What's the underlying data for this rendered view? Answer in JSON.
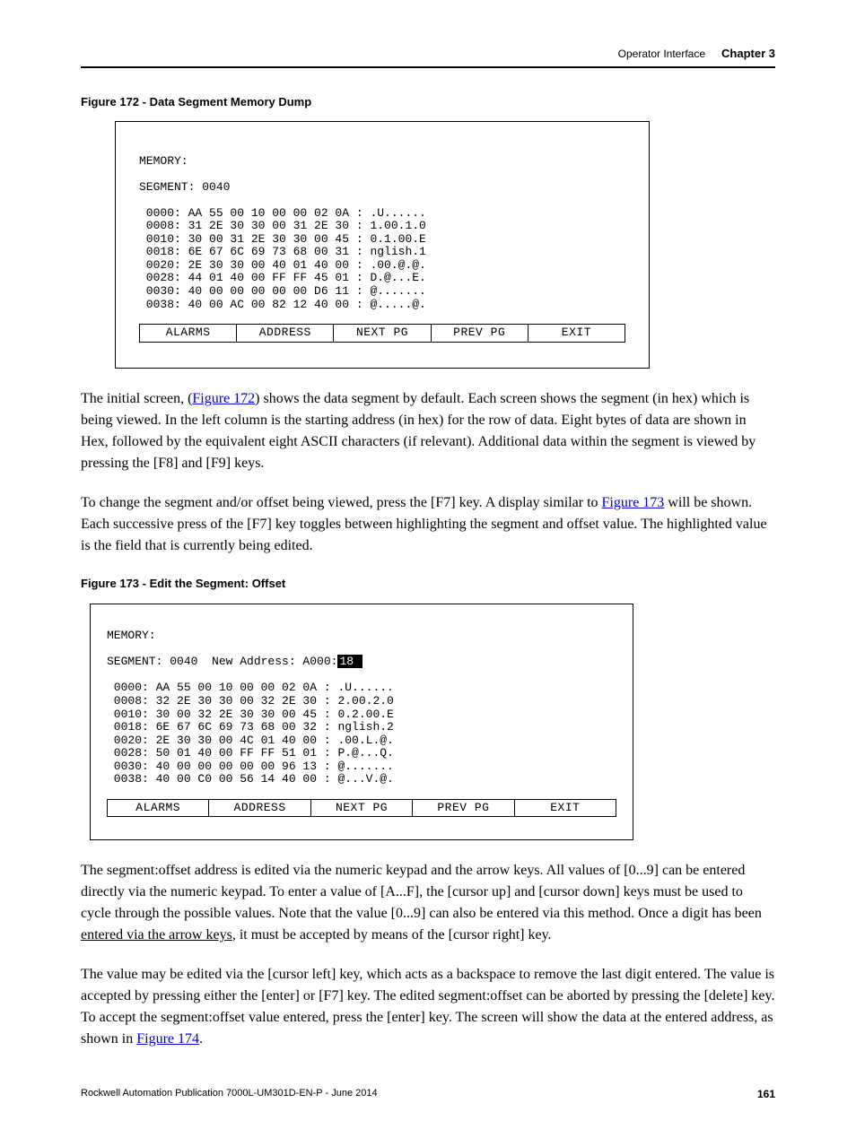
{
  "header": {
    "section": "Operator Interface",
    "chapter": "Chapter 3"
  },
  "figure172": {
    "caption": "Figure 172 - Data Segment Memory Dump",
    "title": "MEMORY:",
    "segment_line": "SEGMENT: 0040",
    "rows": [
      " 0000: AA 55 00 10 00 00 02 0A : .U......",
      " 0008: 31 2E 30 30 00 31 2E 30 : 1.00.1.0",
      " 0010: 30 00 31 2E 30 30 00 45 : 0.1.00.E",
      " 0018: 6E 67 6C 69 73 68 00 31 : nglish.1",
      " 0020: 2E 30 30 00 40 01 40 00 : .00.@.@.",
      " 0028: 44 01 40 00 FF FF 45 01 : D.@...E.",
      " 0030: 40 00 00 00 00 00 D6 11 : @.......",
      " 0038: 40 00 AC 00 82 12 40 00 : @.....@."
    ],
    "buttons": [
      "ALARMS",
      "ADDRESS",
      "NEXT PG",
      "PREV PG",
      "EXIT"
    ]
  },
  "para1_a": "The initial screen, (",
  "para1_link": "Figure 172",
  "para1_b": ") shows the data segment by default. Each screen shows the segment (in hex) which is being viewed. In the left column is the starting address (in hex) for the row of data. Eight bytes of data are shown in Hex, followed by the equivalent eight ASCII characters (if relevant). Additional data within the segment is viewed by pressing the [F8] and [F9] keys.",
  "para2_a": "To change the segment and/or offset being viewed, press the [F7] key. A display similar to ",
  "para2_link": "Figure 173",
  "para2_b": " will be shown. Each successive press of the [F7] key toggles between highlighting the segment and offset value. The highlighted value is the field that is currently being edited.",
  "figure173": {
    "caption": "Figure 173 - Edit the Segment: Offset",
    "title": "MEMORY:",
    "seg_prefix": "SEGMENT: 0040  New Address: A000:",
    "seg_highlight": "18 ",
    "rows": [
      " 0000: AA 55 00 10 00 00 02 0A : .U......",
      " 0008: 32 2E 30 30 00 32 2E 30 : 2.00.2.0",
      " 0010: 30 00 32 2E 30 30 00 45 : 0.2.00.E",
      " 0018: 6E 67 6C 69 73 68 00 32 : nglish.2",
      " 0020: 2E 30 30 00 4C 01 40 00 : .00.L.@.",
      " 0028: 50 01 40 00 FF FF 51 01 : P.@...Q.",
      " 0030: 40 00 00 00 00 00 96 13 : @.......",
      " 0038: 40 00 C0 00 56 14 40 00 : @...V.@."
    ],
    "buttons": [
      "ALARMS",
      "ADDRESS",
      "NEXT PG",
      "PREV PG",
      "EXIT"
    ]
  },
  "para3_a": "The segment:offset address is edited via the numeric keypad and the arrow keys. All values of [0...9] can be entered directly via the numeric keypad. To enter a value of [A...F], the [cursor up] and [cursor down] keys must be used to cycle through the possible values. Note that the value [0...9] can also be entered via this method. Once a digit has been ",
  "para3_u": "entered via the arrow keys",
  "para3_b": ", it must be accepted by means of the [cursor right] key.",
  "para4_a": "The value may be edited via the [cursor left] key, which acts as a backspace to remove the last digit entered. The value is accepted by pressing either the [enter] or [F7] key. The edited segment:offset can be aborted by pressing the [delete] key. To accept the segment:offset value entered, press the [enter] key. The screen will show the data at the entered address, as shown in ",
  "para4_link": "Figure 174",
  "para4_b": ".",
  "footer": {
    "pub": "Rockwell Automation Publication 7000L-UM301D-EN-P - June 2014",
    "page": "161"
  }
}
